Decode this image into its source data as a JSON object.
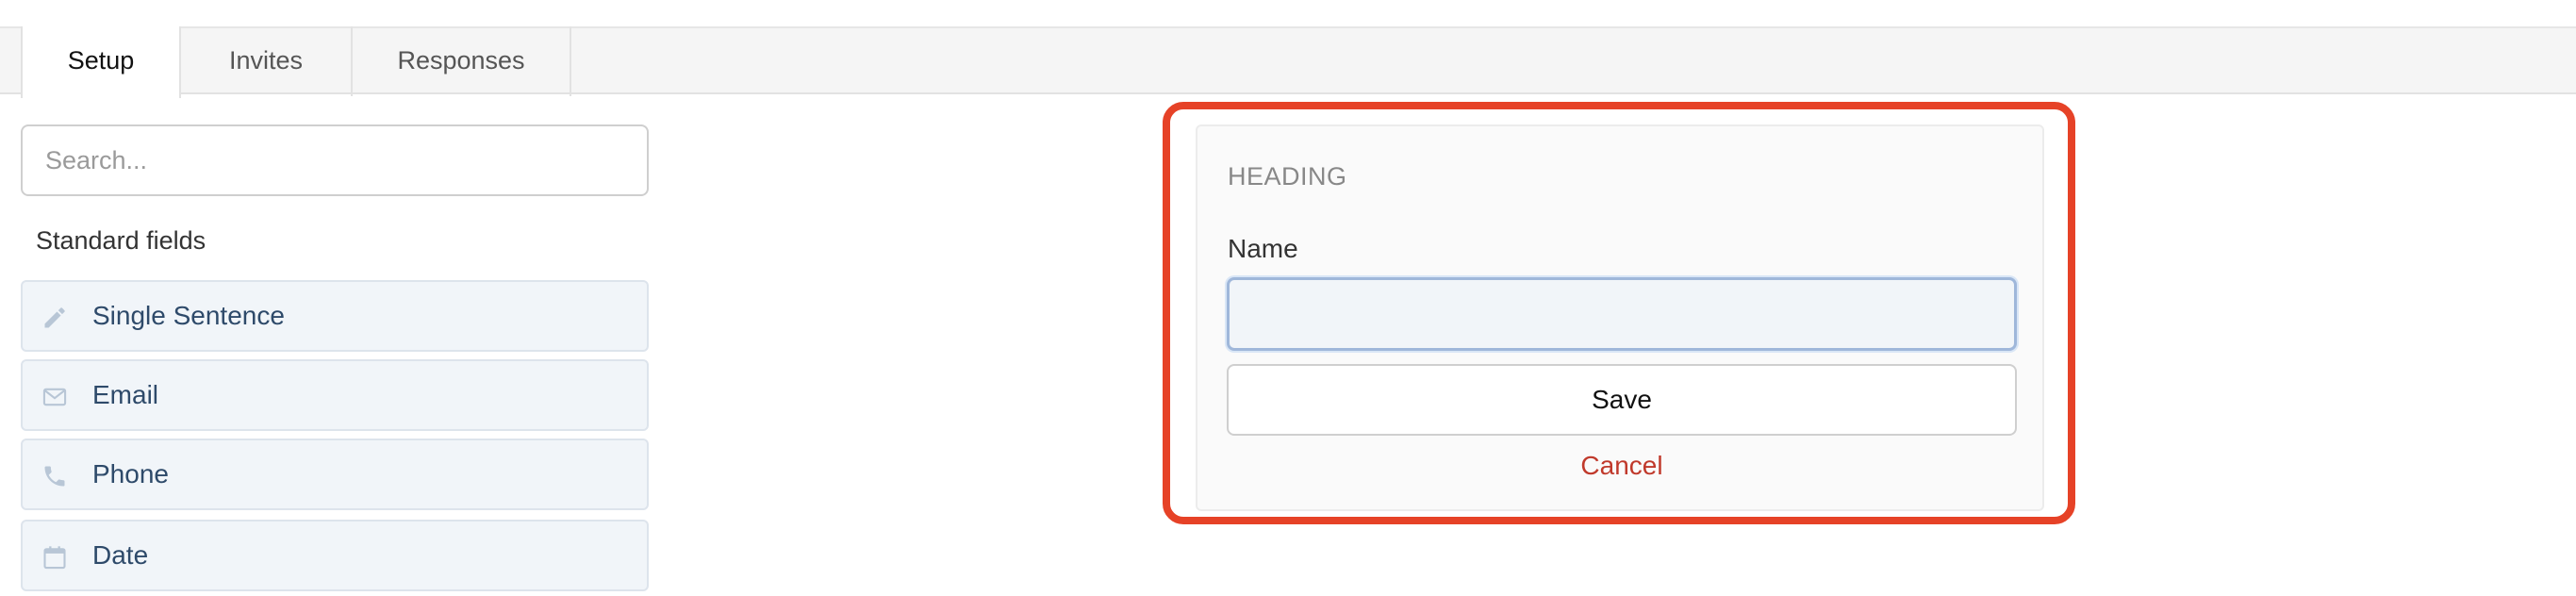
{
  "tabs": {
    "setup": "Setup",
    "invites": "Invites",
    "responses": "Responses",
    "active": "Setup"
  },
  "search": {
    "placeholder": "Search...",
    "value": ""
  },
  "sidebar": {
    "section_title": "Standard fields",
    "items": [
      {
        "label": "Single Sentence",
        "icon": "pencil-icon"
      },
      {
        "label": "Email",
        "icon": "envelope-icon"
      },
      {
        "label": "Phone",
        "icon": "phone-icon"
      },
      {
        "label": "Date",
        "icon": "calendar-icon"
      }
    ]
  },
  "editor": {
    "heading": "HEADING",
    "name_label": "Name",
    "name_value": "",
    "save_label": "Save",
    "cancel_label": "Cancel"
  },
  "colors": {
    "highlight": "#e64227",
    "cancel": "#c0392b",
    "field_text": "#2e4a6a",
    "field_bg": "#f1f5f9"
  }
}
